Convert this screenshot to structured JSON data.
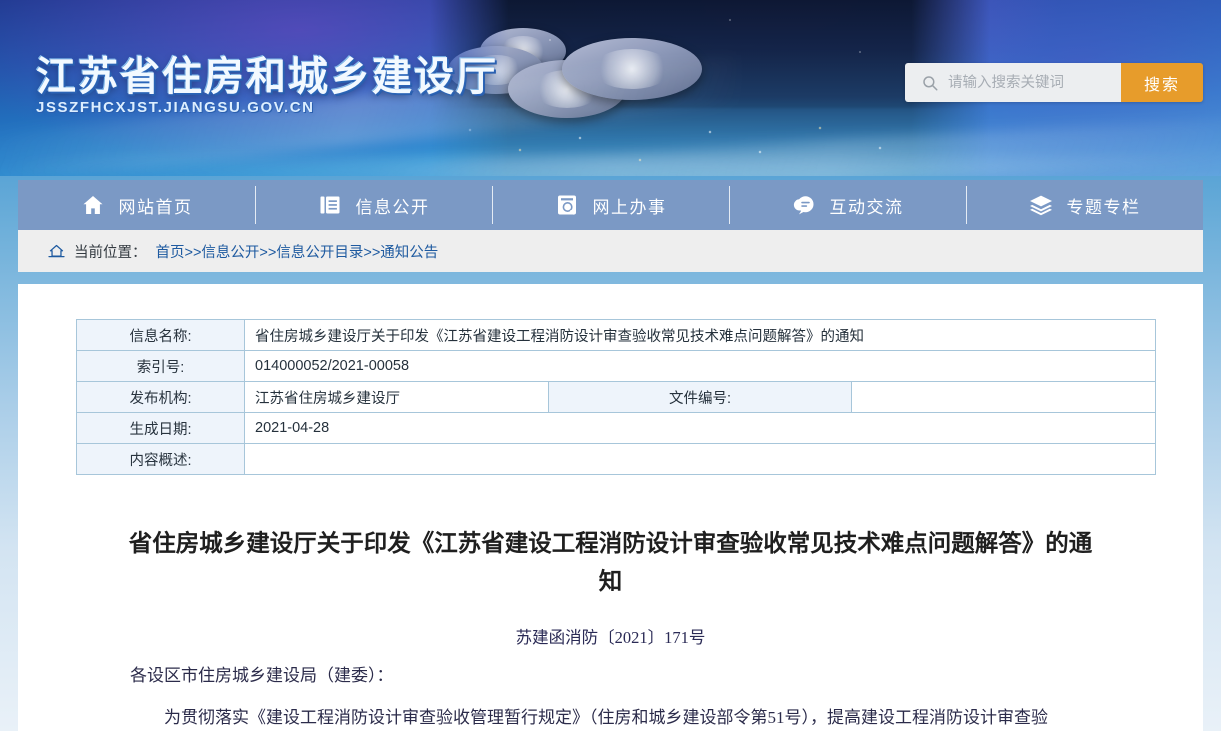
{
  "site": {
    "title": "江苏省住房和城乡建设厅",
    "domain": "JSSZFHCXJST.JIANGSU.GOV.CN"
  },
  "search": {
    "placeholder": "请输入搜索关键词",
    "value": "",
    "button_label": "搜索",
    "icon": "search-icon",
    "button_color": "#e79c2b"
  },
  "nav": {
    "items": [
      {
        "label": "网站首页",
        "icon": "home-icon"
      },
      {
        "label": "信息公开",
        "icon": "book-icon"
      },
      {
        "label": "网上办事",
        "icon": "document-search-icon"
      },
      {
        "label": "互动交流",
        "icon": "chat-bubble-icon"
      },
      {
        "label": "专题专栏",
        "icon": "layers-icon"
      }
    ],
    "background_color": "#7b99c5"
  },
  "breadcrumb": {
    "home_icon": "home-outline-icon",
    "label": "当前位置：",
    "path": "首页>>信息公开>>信息公开目录>>通知公告"
  },
  "info_table": {
    "rows": [
      {
        "label": "信息名称:",
        "value": "省住房城乡建设厅关于印发《江苏省建设工程消防设计审查验收常见技术难点问题解答》的通知"
      },
      {
        "label": "索引号:",
        "value": "014000052/2021-00058"
      },
      {
        "label": "发布机构:",
        "value": "江苏省住房城乡建设厅",
        "label2": "文件编号:",
        "value2": ""
      },
      {
        "label": "生成日期:",
        "value": "2021-04-28"
      },
      {
        "label": "内容概述:",
        "value": ""
      }
    ]
  },
  "document": {
    "title": "省住房城乡建设厅关于印发《江苏省建设工程消防设计审查验收常见技术难点问题解答》的通知",
    "number": "苏建函消防〔2021〕171号",
    "salutation": "各设区市住房城乡建设局（建委）：",
    "body_1": "为贯彻落实《建设工程消防设计审查验收管理暂行规定》（住房和城乡建设部令第51号），提高建设工程消防设计审查验"
  }
}
